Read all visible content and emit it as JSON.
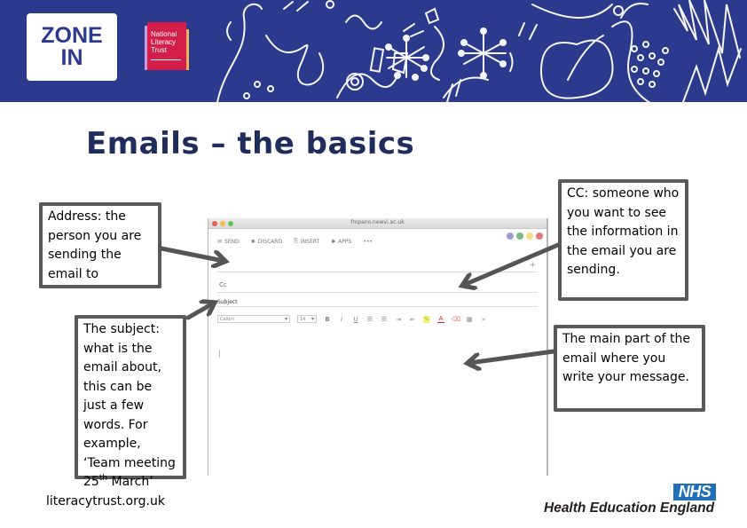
{
  "header": {
    "zone_logo": {
      "line1": "ZONE",
      "line2": "IN"
    },
    "partner_logo": {
      "line1": "National",
      "line2": "Literacy",
      "line3": "Trust"
    },
    "background_color": "#2b3a8c"
  },
  "title": "Emails – the basics",
  "callouts": {
    "address": "Address: the person you are sending the email to",
    "subject": {
      "text_before": "The subject: what is the email about, this can be just a few words. For example, ‘Team meeting 25",
      "superscript": "th",
      "text_after": " March’"
    },
    "cc": "CC: someone who you want to see the information in the email you are sending.",
    "body": "The main part of the email where you write your message."
  },
  "email_client": {
    "url": "fmpano.newvi.ac.uk",
    "toolbar": [
      {
        "icon": "send-icon",
        "glyph": "✉",
        "label": "SEND"
      },
      {
        "icon": "discard-icon",
        "glyph": "✖",
        "label": "DISCARD"
      },
      {
        "icon": "attach-icon",
        "glyph": "⎘",
        "label": "INSERT"
      },
      {
        "icon": "apps-icon",
        "glyph": "✱",
        "label": "APPS"
      },
      {
        "icon": "more-icon",
        "glyph": "•••",
        "label": ""
      }
    ],
    "add_recipient": "+",
    "cc_label": "Cc",
    "subject_label": "Subject",
    "font_family_value": "Calibri",
    "font_size_value": "14",
    "format_buttons": [
      {
        "name": "bold-icon",
        "glyph": "B",
        "style": ""
      },
      {
        "name": "italic-icon",
        "glyph": "I",
        "style": ""
      },
      {
        "name": "underline-icon",
        "glyph": "U",
        "style": ""
      },
      {
        "name": "bullet-list-icon",
        "glyph": "☰",
        "style": ""
      },
      {
        "name": "numbered-list-icon",
        "glyph": "☰",
        "style": ""
      },
      {
        "name": "indent-icon",
        "glyph": "⇥",
        "style": ""
      },
      {
        "name": "outdent-icon",
        "glyph": "⇤",
        "style": ""
      },
      {
        "name": "highlight-icon",
        "glyph": "✎",
        "style": "hl"
      },
      {
        "name": "font-color-icon",
        "glyph": "A",
        "style": "fc"
      },
      {
        "name": "clear-format-icon",
        "glyph": "⌫",
        "style": "cl"
      },
      {
        "name": "table-icon",
        "glyph": "▦",
        "style": ""
      },
      {
        "name": "expand-icon",
        "glyph": "»",
        "style": ""
      }
    ]
  },
  "footer": {
    "link": "literacytrust.org.uk",
    "nhs_badge": "NHS",
    "org_name": "Health Education England"
  }
}
